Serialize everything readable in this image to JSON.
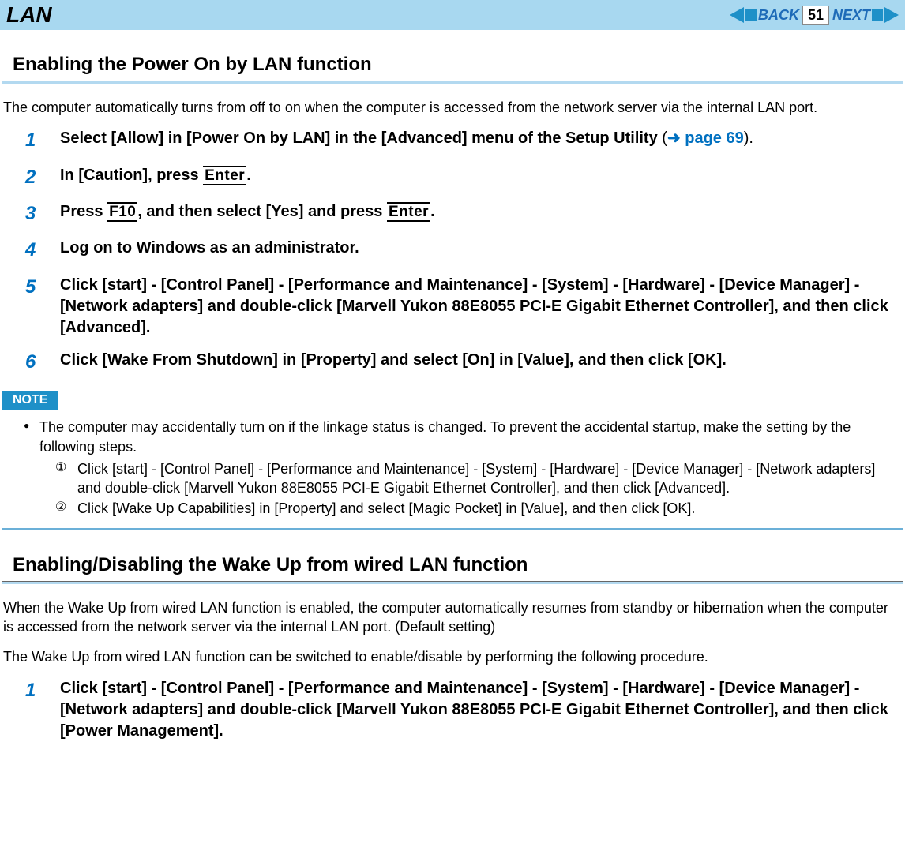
{
  "header": {
    "title": "LAN",
    "back": "BACK",
    "next": "NEXT",
    "page": "51"
  },
  "section1": {
    "heading": "Enabling the Power On by LAN function",
    "intro": "The computer automatically turns from off to on when the computer is accessed from the network server via the internal LAN port.",
    "steps": {
      "1": {
        "pre": "Select [Allow] in [Power On by LAN] in the [Advanced] menu of the Setup Utility ",
        "open": "(",
        "arrowtext": "➜ page 69",
        "close": ")."
      },
      "2": {
        "pre": "In [Caution], press ",
        "key1": "Enter",
        "post": "."
      },
      "3": {
        "pre": "Press ",
        "key1": "F10",
        "mid": ", and then select [Yes] and press ",
        "key2": "Enter",
        "post": "."
      },
      "4": "Log on to Windows as an administrator.",
      "5": "Click [start] - [Control Panel] - [Performance and Maintenance] - [System] - [Hardware] - [Device Manager] - [Network adapters] and double-click [Marvell Yukon 88E8055 PCI-E Gigabit Ethernet Controller], and then click [Advanced].",
      "6": "Click [Wake From Shutdown] in [Property] and select [On] in [Value], and then click [OK]."
    }
  },
  "note": {
    "label": "NOTE",
    "bullet": "The computer may accidentally turn on if the linkage status is changed. To prevent the accidental startup, make the setting by the following steps.",
    "sub": {
      "a_marker": "①",
      "a": "Click [start] - [Control Panel] - [Performance and Maintenance] - [System] - [Hardware] - [Device Manager] - [Network adapters] and double-click [Marvell Yukon 88E8055 PCI-E Gigabit Ethernet Controller], and then click [Advanced].",
      "b_marker": "②",
      "b": "Click [Wake Up Capabilities] in [Property] and select [Magic Pocket] in [Value], and then click [OK]."
    }
  },
  "section2": {
    "heading": "Enabling/Disabling the Wake Up from wired LAN function",
    "intro1": "When the Wake Up from wired LAN function is enabled, the computer automatically resumes from standby or hibernation when the computer is accessed from the network server via the internal LAN port. (Default setting)",
    "intro2": "The Wake Up from wired LAN function can be switched to enable/disable by performing the following procedure.",
    "steps": {
      "1": "Click [start] - [Control Panel] - [Performance and Maintenance] - [System] - [Hardware] - [Device Manager] - [Network adapters] and double-click [Marvell Yukon 88E8055 PCI-E Gigabit Ethernet Controller], and then click [Power Management]."
    }
  }
}
